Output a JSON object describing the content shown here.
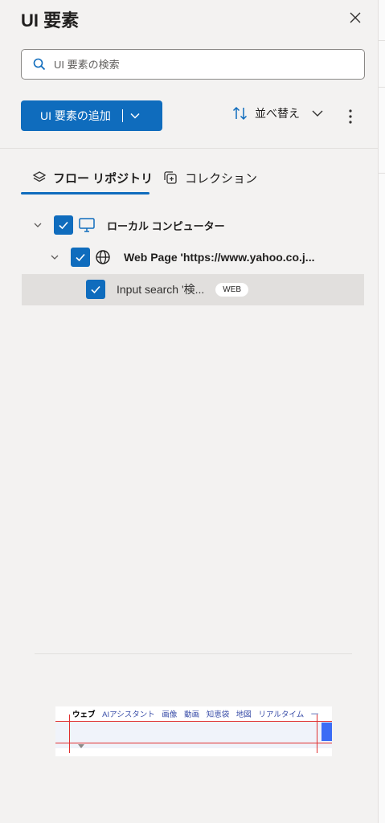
{
  "header": {
    "title": "UI 要素"
  },
  "search": {
    "placeholder": "UI 要素の検索"
  },
  "toolbar": {
    "add_label": "UI 要素の追加",
    "sort_label": "並べ替え"
  },
  "tabs": [
    {
      "label": "フロー リポジトリ",
      "active": true
    },
    {
      "label": "コレクション",
      "active": false
    }
  ],
  "tree": {
    "root": {
      "label": "ローカル コンピューター",
      "checked": true
    },
    "page": {
      "label": "Web Page 'https://www.yahoo.co.j...",
      "checked": true
    },
    "element": {
      "label": "Input search '検...",
      "badge": "WEB",
      "checked": true,
      "selected": true
    }
  },
  "preview": {
    "tabs": [
      "ウェブ",
      "AIアシスタント",
      "画像",
      "動画",
      "知恵袋",
      "地図",
      "リアルタイム",
      "一"
    ]
  },
  "colors": {
    "accent": "#0f6cbd",
    "highlight_border": "#e03030",
    "background": "#f3f2f1"
  }
}
